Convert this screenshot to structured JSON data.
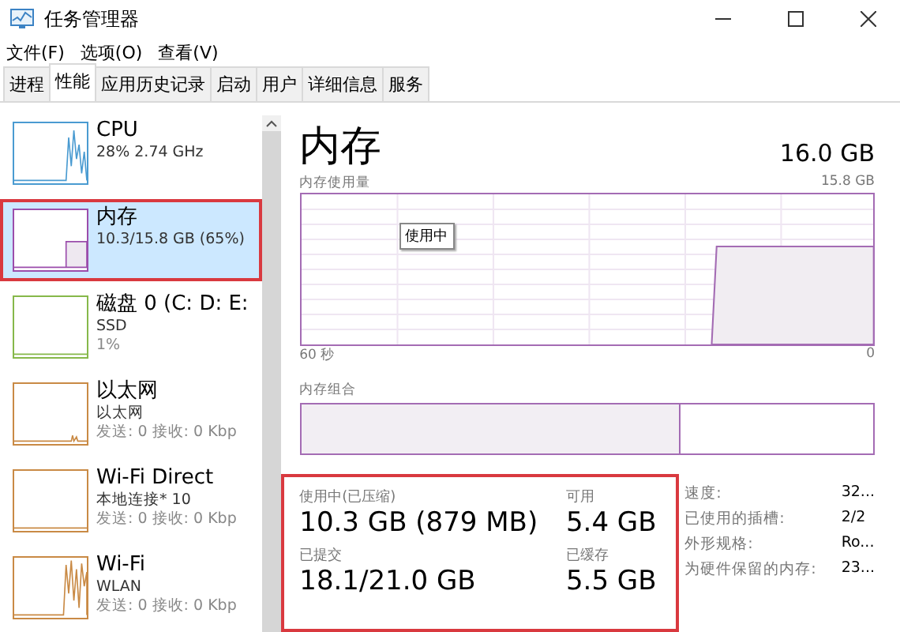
{
  "window": {
    "title": "任务管理器"
  },
  "menu": [
    "文件(F)",
    "选项(O)",
    "查看(V)"
  ],
  "tabs": [
    {
      "label": "进程",
      "selected": false
    },
    {
      "label": "性能",
      "selected": true
    },
    {
      "label": "应用历史记录",
      "selected": false
    },
    {
      "label": "启动",
      "selected": false
    },
    {
      "label": "用户",
      "selected": false
    },
    {
      "label": "详细信息",
      "selected": false
    },
    {
      "label": "服务",
      "selected": false
    }
  ],
  "sidebar": {
    "items": [
      {
        "name": "CPU",
        "lines": [
          "28% 2.74 GHz"
        ],
        "color": "#4a9bd1",
        "kind": "spike",
        "selected": false
      },
      {
        "name": "内存",
        "lines": [
          "10.3/15.8 GB (65%)"
        ],
        "color": "#9b4dab",
        "kind": "step",
        "selected": true
      },
      {
        "name": "磁盘 0 (C: D: E:",
        "lines": [
          "SSD",
          "1%"
        ],
        "color": "#86b84a",
        "kind": "flat",
        "selected": false
      },
      {
        "name": "以太网",
        "lines": [
          "以太网",
          "发送: 0 接收: 0 Kbp"
        ],
        "color": "#c98a45",
        "kind": "ticks",
        "selected": false
      },
      {
        "name": "Wi-Fi Direct",
        "lines": [
          "本地连接* 10",
          "发送: 0 接收: 0 Kbp"
        ],
        "color": "#c98a45",
        "kind": "flat",
        "selected": false
      },
      {
        "name": "Wi-Fi",
        "lines": [
          "WLAN",
          "发送: 0 接收: 0 Kbp"
        ],
        "color": "#c98a45",
        "kind": "noise",
        "selected": false
      }
    ]
  },
  "detail": {
    "title": "内存",
    "total": "16.0 GB",
    "usage_label": "内存使用量",
    "usage_max": "15.8 GB",
    "tooltip": "使用中",
    "time_span": "60 秒",
    "usage_min": "0",
    "composition_label": "内存组合",
    "composition": {
      "level": 0.66
    },
    "stats": [
      {
        "label": "使用中(已压缩)",
        "value": "10.3 GB (879 MB)"
      },
      {
        "label": "可用",
        "value": "5.4 GB"
      },
      {
        "label": "已提交",
        "value": "18.1/21.0 GB"
      },
      {
        "label": "已缓存",
        "value": "5.5 GB"
      }
    ],
    "info": [
      {
        "label": "速度:",
        "value": "32..."
      },
      {
        "label": "已使用的插槽:",
        "value": "2/2"
      },
      {
        "label": "外形规格:",
        "value": "Ro..."
      },
      {
        "label": "为硬件保留的内存:",
        "value": "23..."
      }
    ]
  }
}
